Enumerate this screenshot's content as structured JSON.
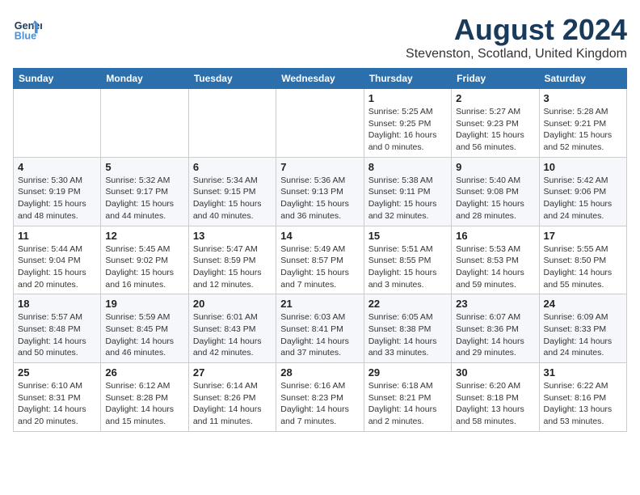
{
  "header": {
    "logo_line1": "General",
    "logo_line2": "Blue",
    "month_title": "August 2024",
    "location": "Stevenston, Scotland, United Kingdom"
  },
  "weekdays": [
    "Sunday",
    "Monday",
    "Tuesday",
    "Wednesday",
    "Thursday",
    "Friday",
    "Saturday"
  ],
  "weeks": [
    [
      {
        "day": "",
        "info": ""
      },
      {
        "day": "",
        "info": ""
      },
      {
        "day": "",
        "info": ""
      },
      {
        "day": "",
        "info": ""
      },
      {
        "day": "1",
        "info": "Sunrise: 5:25 AM\nSunset: 9:25 PM\nDaylight: 16 hours\nand 0 minutes."
      },
      {
        "day": "2",
        "info": "Sunrise: 5:27 AM\nSunset: 9:23 PM\nDaylight: 15 hours\nand 56 minutes."
      },
      {
        "day": "3",
        "info": "Sunrise: 5:28 AM\nSunset: 9:21 PM\nDaylight: 15 hours\nand 52 minutes."
      }
    ],
    [
      {
        "day": "4",
        "info": "Sunrise: 5:30 AM\nSunset: 9:19 PM\nDaylight: 15 hours\nand 48 minutes."
      },
      {
        "day": "5",
        "info": "Sunrise: 5:32 AM\nSunset: 9:17 PM\nDaylight: 15 hours\nand 44 minutes."
      },
      {
        "day": "6",
        "info": "Sunrise: 5:34 AM\nSunset: 9:15 PM\nDaylight: 15 hours\nand 40 minutes."
      },
      {
        "day": "7",
        "info": "Sunrise: 5:36 AM\nSunset: 9:13 PM\nDaylight: 15 hours\nand 36 minutes."
      },
      {
        "day": "8",
        "info": "Sunrise: 5:38 AM\nSunset: 9:11 PM\nDaylight: 15 hours\nand 32 minutes."
      },
      {
        "day": "9",
        "info": "Sunrise: 5:40 AM\nSunset: 9:08 PM\nDaylight: 15 hours\nand 28 minutes."
      },
      {
        "day": "10",
        "info": "Sunrise: 5:42 AM\nSunset: 9:06 PM\nDaylight: 15 hours\nand 24 minutes."
      }
    ],
    [
      {
        "day": "11",
        "info": "Sunrise: 5:44 AM\nSunset: 9:04 PM\nDaylight: 15 hours\nand 20 minutes."
      },
      {
        "day": "12",
        "info": "Sunrise: 5:45 AM\nSunset: 9:02 PM\nDaylight: 15 hours\nand 16 minutes."
      },
      {
        "day": "13",
        "info": "Sunrise: 5:47 AM\nSunset: 8:59 PM\nDaylight: 15 hours\nand 12 minutes."
      },
      {
        "day": "14",
        "info": "Sunrise: 5:49 AM\nSunset: 8:57 PM\nDaylight: 15 hours\nand 7 minutes."
      },
      {
        "day": "15",
        "info": "Sunrise: 5:51 AM\nSunset: 8:55 PM\nDaylight: 15 hours\nand 3 minutes."
      },
      {
        "day": "16",
        "info": "Sunrise: 5:53 AM\nSunset: 8:53 PM\nDaylight: 14 hours\nand 59 minutes."
      },
      {
        "day": "17",
        "info": "Sunrise: 5:55 AM\nSunset: 8:50 PM\nDaylight: 14 hours\nand 55 minutes."
      }
    ],
    [
      {
        "day": "18",
        "info": "Sunrise: 5:57 AM\nSunset: 8:48 PM\nDaylight: 14 hours\nand 50 minutes."
      },
      {
        "day": "19",
        "info": "Sunrise: 5:59 AM\nSunset: 8:45 PM\nDaylight: 14 hours\nand 46 minutes."
      },
      {
        "day": "20",
        "info": "Sunrise: 6:01 AM\nSunset: 8:43 PM\nDaylight: 14 hours\nand 42 minutes."
      },
      {
        "day": "21",
        "info": "Sunrise: 6:03 AM\nSunset: 8:41 PM\nDaylight: 14 hours\nand 37 minutes."
      },
      {
        "day": "22",
        "info": "Sunrise: 6:05 AM\nSunset: 8:38 PM\nDaylight: 14 hours\nand 33 minutes."
      },
      {
        "day": "23",
        "info": "Sunrise: 6:07 AM\nSunset: 8:36 PM\nDaylight: 14 hours\nand 29 minutes."
      },
      {
        "day": "24",
        "info": "Sunrise: 6:09 AM\nSunset: 8:33 PM\nDaylight: 14 hours\nand 24 minutes."
      }
    ],
    [
      {
        "day": "25",
        "info": "Sunrise: 6:10 AM\nSunset: 8:31 PM\nDaylight: 14 hours\nand 20 minutes."
      },
      {
        "day": "26",
        "info": "Sunrise: 6:12 AM\nSunset: 8:28 PM\nDaylight: 14 hours\nand 15 minutes."
      },
      {
        "day": "27",
        "info": "Sunrise: 6:14 AM\nSunset: 8:26 PM\nDaylight: 14 hours\nand 11 minutes."
      },
      {
        "day": "28",
        "info": "Sunrise: 6:16 AM\nSunset: 8:23 PM\nDaylight: 14 hours\nand 7 minutes."
      },
      {
        "day": "29",
        "info": "Sunrise: 6:18 AM\nSunset: 8:21 PM\nDaylight: 14 hours\nand 2 minutes."
      },
      {
        "day": "30",
        "info": "Sunrise: 6:20 AM\nSunset: 8:18 PM\nDaylight: 13 hours\nand 58 minutes."
      },
      {
        "day": "31",
        "info": "Sunrise: 6:22 AM\nSunset: 8:16 PM\nDaylight: 13 hours\nand 53 minutes."
      }
    ]
  ]
}
